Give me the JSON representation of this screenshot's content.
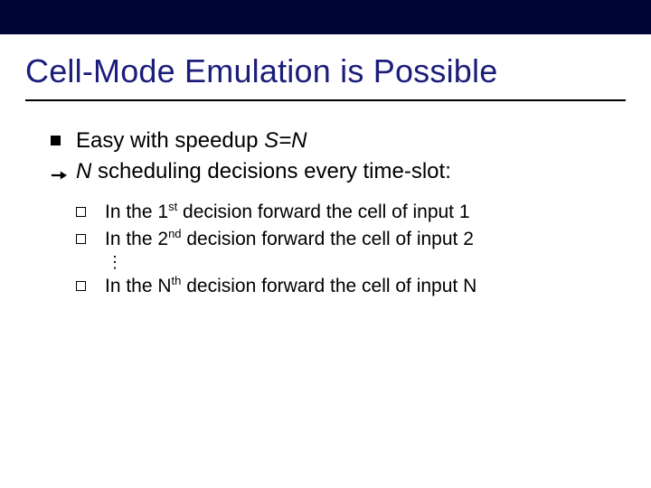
{
  "title": "Cell-Mode Emulation is Possible",
  "bullets": {
    "b1_prefix": "Easy with speedup ",
    "b1_expr": "S=N",
    "b2_var": "N",
    "b2_rest": " scheduling decisions every time-slot:",
    "s1_a": "In the 1",
    "s1_sup": "st",
    "s1_b": " decision forward the cell of input 1",
    "s2_a": "In the 2",
    "s2_sup": "nd",
    "s2_b": " decision forward the cell of input 2",
    "vdots": "⋮",
    "sN_a": "In the N",
    "sN_sup": "th",
    "sN_b": " decision forward the cell of input N"
  }
}
